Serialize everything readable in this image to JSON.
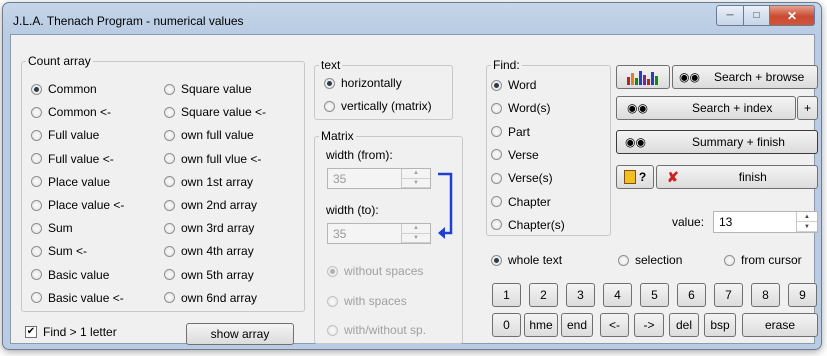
{
  "window": {
    "title": "J.L.A. Thenach Program - numerical values"
  },
  "count_array": {
    "legend": "Count array",
    "col1": [
      "Common",
      "Common <-",
      "Full value",
      "Full value <-",
      "Place value",
      "Place value <-",
      "Sum",
      "Sum <-",
      "Basic value",
      "Basic value <-"
    ],
    "col2": [
      "Square value",
      "Square value <-",
      "own full value",
      "own full vlue <-",
      "own 1st array",
      "own 2nd array",
      "own 3rd array",
      "own 4th array",
      "own 5th array",
      "own 6nd array"
    ],
    "selected": "Common",
    "find_gt1_label": "Find > 1 letter",
    "show_array_label": "show array"
  },
  "text_group": {
    "legend": "text",
    "horizontally": "horizontally",
    "vertically": "vertically (matrix)"
  },
  "matrix": {
    "legend": "Matrix",
    "width_from_label": "width (from):",
    "width_from_value": "35",
    "width_to_label": "width (to):",
    "width_to_value": "35",
    "without_spaces": "without spaces",
    "with_spaces": "with spaces",
    "with_without": "with/without sp."
  },
  "find": {
    "legend": "Find:",
    "items": [
      "Word",
      "Word(s)",
      "Part",
      "Verse",
      "Verse(s)",
      "Chapter",
      "Chapter(s)"
    ]
  },
  "actions": {
    "search_browse": "Search + browse",
    "search_index": "Search + index",
    "plus": "+",
    "summary_finish": "Summary + finish",
    "help": "?",
    "finish": "finish",
    "value_label": "value:",
    "value": "13"
  },
  "scope": {
    "whole_text": "whole text",
    "selection": "selection",
    "from_cursor": "from cursor"
  },
  "keypad": {
    "row1": [
      "1",
      "2",
      "3",
      "4",
      "5",
      "6",
      "7",
      "8",
      "9"
    ],
    "row2": [
      "0",
      "hme",
      "end",
      "<-",
      "->",
      "del",
      "bsp",
      "erase"
    ]
  },
  "colors": {
    "title_bar": "#b9cce3",
    "close_button": "#c94a30",
    "arrow_blue": "#1f3fd0",
    "cross_red": "#d02020"
  }
}
